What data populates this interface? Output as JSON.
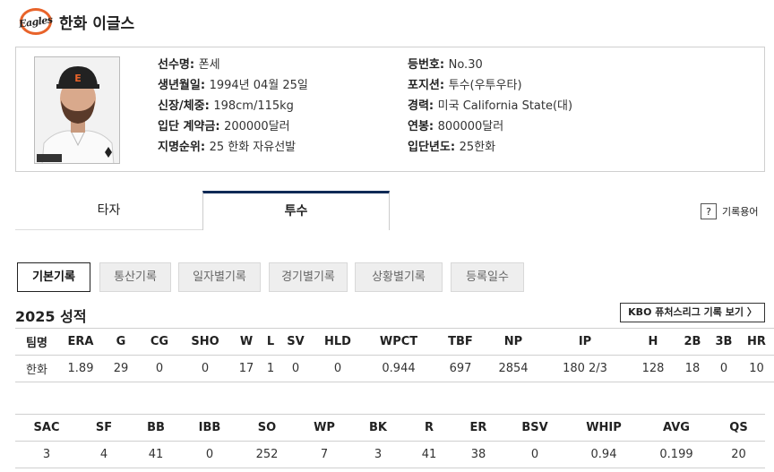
{
  "header": {
    "logo_text": "Eagles",
    "team_name": "한화 이글스"
  },
  "player": {
    "rows_left": [
      {
        "label": "선수명: ",
        "value": "폰세"
      },
      {
        "label": "생년월일: ",
        "value": "1994년 04월 25일"
      },
      {
        "label": "신장/체중: ",
        "value": "198cm/115kg"
      },
      {
        "label": "입단 계약금: ",
        "value": "200000달러"
      },
      {
        "label": "지명순위: ",
        "value": "25 한화 자유선발"
      }
    ],
    "rows_right": [
      {
        "label": "등번호: ",
        "value": "No.30"
      },
      {
        "label": "포지션: ",
        "value": "투수(우투우타)"
      },
      {
        "label": "경력: ",
        "value": "미국 California State(대)"
      },
      {
        "label": "연봉: ",
        "value": "800000달러"
      },
      {
        "label": "입단년도: ",
        "value": "25한화"
      }
    ]
  },
  "tabs": {
    "batter": "타자",
    "pitcher": "투수"
  },
  "glossary": {
    "icon": "?",
    "label": "기록용어"
  },
  "subtabs": [
    "기본기록",
    "통산기록",
    "일자별기록",
    "경기별기록",
    "상황별기록",
    "등록일수"
  ],
  "section_title": "2025 성적",
  "futures_link": "KBO 퓨처스리그 기록 보기 〉",
  "table1": {
    "headers": [
      "팀명",
      "ERA",
      "G",
      "CG",
      "SHO",
      "W",
      "L",
      "SV",
      "HLD",
      "WPCT",
      "TBF",
      "NP",
      "IP",
      "H",
      "2B",
      "3B",
      "HR"
    ],
    "rows": [
      [
        "한화",
        "1.89",
        "29",
        "0",
        "0",
        "17",
        "1",
        "0",
        "0",
        "0.944",
        "697",
        "2854",
        "180 2/3",
        "128",
        "18",
        "0",
        "10"
      ]
    ]
  },
  "table2": {
    "headers": [
      "SAC",
      "SF",
      "BB",
      "IBB",
      "SO",
      "WP",
      "BK",
      "R",
      "ER",
      "BSV",
      "WHIP",
      "AVG",
      "QS"
    ],
    "rows": [
      [
        "3",
        "4",
        "41",
        "0",
        "252",
        "7",
        "3",
        "41",
        "38",
        "0",
        "0.94",
        "0.199",
        "20"
      ]
    ]
  },
  "colors": {
    "accent_navy": "#0f2a56",
    "logo_orange": "#e8632a"
  }
}
